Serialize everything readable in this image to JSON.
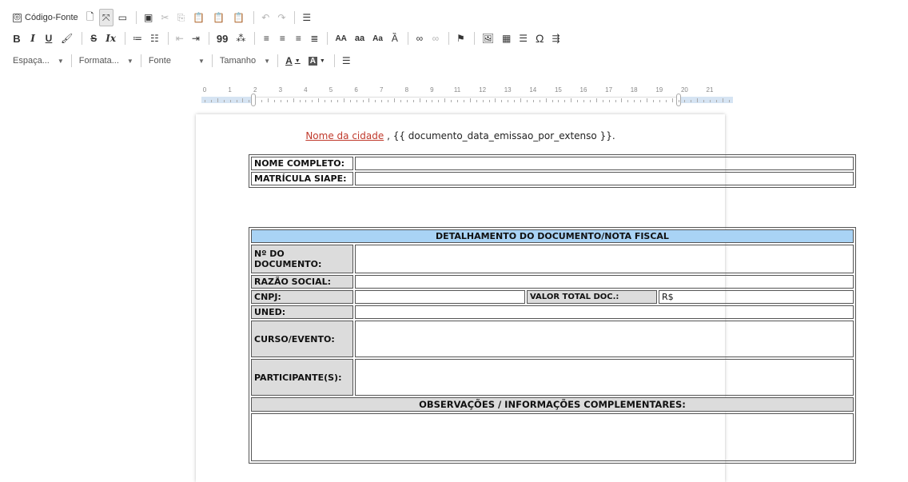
{
  "toolbar": {
    "row1": {
      "source_label": "Código-Fonte"
    },
    "row2": {
      "bold": "B",
      "italic": "I",
      "underline": "U",
      "strike": "S",
      "remove_format": "Ix",
      "uppercase": "AA",
      "lowercase": "aa",
      "capitalize": "Aa",
      "blockquote": "99",
      "special_char": "Ω"
    },
    "row3": {
      "spacing": "Espaça...",
      "format": "Formata...",
      "font": "Fonte",
      "size": "Tamanho",
      "text_color": "A",
      "bg_color": "A"
    }
  },
  "ruler": {
    "numbers": [
      "0",
      "1",
      "2",
      "3",
      "4",
      "5",
      "6",
      "7",
      "8",
      "9",
      "11",
      "12",
      "13",
      "14",
      "15",
      "16",
      "17",
      "18",
      "19",
      "20",
      "21"
    ]
  },
  "document": {
    "city_link": "Nome da cidade",
    "date_suffix": ", {{ documento_data_emissao_por_extenso }}.",
    "id_table": {
      "name_label": "NOME COMPLETO:",
      "siape_label": "MATRÍCULA SIAPE:"
    },
    "detail_table": {
      "header": "DETALHAMENTO DO DOCUMENTO/NOTA FISCAL",
      "doc_number_label": "Nº DO DOCUMENTO:",
      "razao_label": "RAZÃO SOCIAL:",
      "cnpj_label": "CNPJ:",
      "total_label": "VALOR TOTAL DOC.:",
      "total_value": "R$",
      "uned_label": "UNED:",
      "curso_label": "CURSO/EVENTO:",
      "participantes_label": "PARTICIPANTE(S):",
      "observacoes_header": "OBSERVAÇÕES / INFORMAÇÕES COMPLEMENTARES:"
    }
  }
}
